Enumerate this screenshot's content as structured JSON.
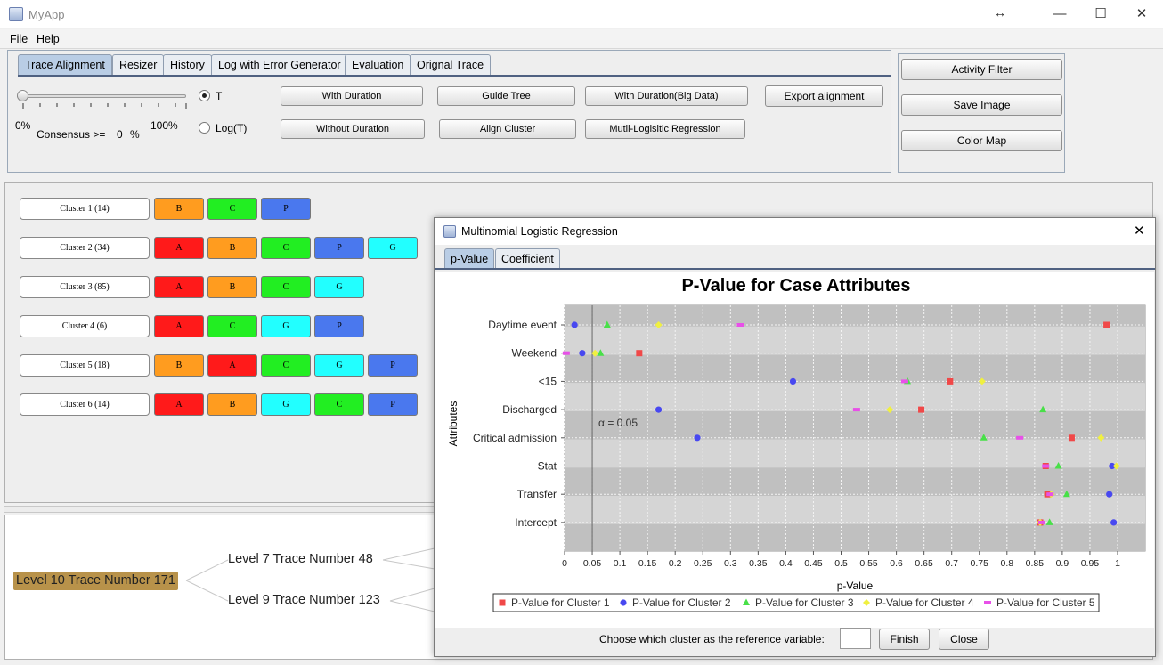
{
  "window": {
    "title": "MyApp",
    "controls": [
      "—",
      "☐",
      "✕"
    ],
    "resize_glyph": "↔"
  },
  "menu": [
    "File",
    "Help"
  ],
  "tabs": [
    "Trace Alignment",
    "Resizer",
    "History",
    "Log with Error Generator",
    "Evaluation",
    "Orignal Trace"
  ],
  "controls": {
    "slider_min": "0%",
    "slider_max": "100%",
    "consensus_label": "Consensus >=",
    "consensus_value": "0",
    "consensus_unit": "%",
    "radio_t": "T",
    "radio_logt": "Log(T)",
    "slider_value": 0
  },
  "buttons": {
    "with_duration": "With Duration",
    "without_duration": "Without Duration",
    "guide_tree": "Guide Tree",
    "align_cluster": "Align Cluster",
    "with_duration_big": "With Duration(Big Data)",
    "mlr": "Mutli-Logisitic Regression",
    "export": "Export alignment"
  },
  "side_buttons": [
    "Activity Filter",
    "Save Image",
    "Color Map"
  ],
  "colors": {
    "A": "#ff1a1a",
    "B": "#ff9c1f",
    "C": "#22ee22",
    "P": "#4a78ee",
    "G": "#22ffff"
  },
  "clusters": [
    {
      "name": "Cluster 1 (14)",
      "acts": [
        "B",
        "C",
        "P"
      ]
    },
    {
      "name": "Cluster 2 (34)",
      "acts": [
        "A",
        "B",
        "C",
        "P",
        "G"
      ]
    },
    {
      "name": "Cluster 3 (85)",
      "acts": [
        "A",
        "B",
        "C",
        "G"
      ]
    },
    {
      "name": "Cluster 4 (6)",
      "acts": [
        "A",
        "C",
        "G",
        "P"
      ]
    },
    {
      "name": "Cluster 5 (18)",
      "acts": [
        "B",
        "A",
        "C",
        "G",
        "P"
      ]
    },
    {
      "name": "Cluster 6 (14)",
      "acts": [
        "A",
        "B",
        "G",
        "C",
        "P"
      ]
    }
  ],
  "tree": {
    "root": "Level 10 Trace Number 171",
    "child1": "Level 7 Trace Number 48",
    "child2": "Level 9 Trace Number 123"
  },
  "dialog": {
    "title": "Multinomial Logistic Regression",
    "close": "✕",
    "tabs": [
      "p-Value",
      "Coefficient"
    ],
    "reference_label": "Choose which cluster as the reference variable:",
    "reference_value": "",
    "finish": "Finish",
    "close_btn": "Close"
  },
  "chart_data": {
    "type": "scatter",
    "title": "P-Value for Case Attributes",
    "xlabel": "p-Value",
    "ylabel": "Attributes",
    "xlim": [
      0,
      1.05
    ],
    "xticks": [
      "0",
      "0.05",
      "0.1",
      "0.15",
      "0.2",
      "0.25",
      "0.3",
      "0.35",
      "0.4",
      "0.45",
      "0.5",
      "0.55",
      "0.6",
      "0.65",
      "0.7",
      "0.75",
      "0.8",
      "0.85",
      "0.9",
      "0.95",
      "1"
    ],
    "categories": [
      "Daytime event",
      "Weekend",
      "<15",
      "Discharged",
      "Critical admission",
      "Stat",
      "Transfer",
      "Intercept"
    ],
    "annotation": {
      "text": "α = 0.05",
      "x": 0.05
    },
    "legend_position": "bottom",
    "grid": true,
    "series": [
      {
        "name": "P-Value for Cluster 1",
        "color": "#f04848",
        "marker": "square",
        "values": [
          0.98,
          0.135,
          0.697,
          0.645,
          0.917,
          0.87,
          0.873,
          0.86
        ]
      },
      {
        "name": "P-Value for Cluster 2",
        "color": "#4848f0",
        "marker": "circle",
        "values": [
          0.018,
          0.032,
          0.413,
          0.17,
          0.24,
          0.99,
          0.985,
          0.993
        ]
      },
      {
        "name": "P-Value for Cluster 3",
        "color": "#48e048",
        "marker": "triangle",
        "values": [
          0.077,
          0.065,
          0.62,
          0.865,
          0.758,
          0.893,
          0.908,
          0.877
        ]
      },
      {
        "name": "P-Value for Cluster 4",
        "color": "#f0f040",
        "marker": "diamond",
        "values": [
          0.17,
          0.055,
          0.755,
          0.588,
          0.97,
          0.998,
          0.88,
          0.86
        ]
      },
      {
        "name": "P-Value for Cluster 5",
        "color": "#e850e8",
        "marker": "dash",
        "values": [
          0.318,
          0.003,
          0.615,
          0.528,
          0.823,
          0.87,
          0.878,
          0.863
        ]
      }
    ]
  }
}
